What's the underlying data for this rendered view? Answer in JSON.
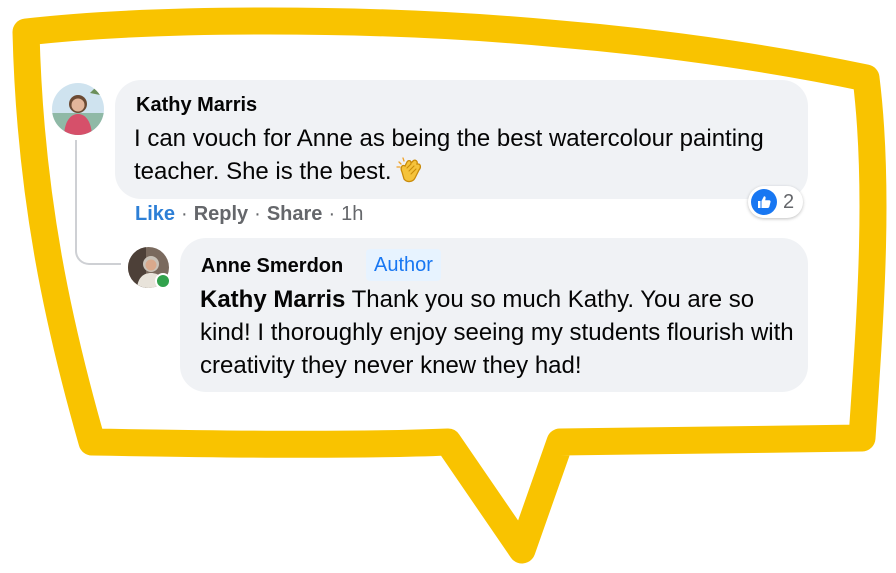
{
  "colors": {
    "frame_stroke": "#f9c300",
    "comment_bg": "#f0f2f5",
    "author_badge_bg": "#e7f3ff",
    "author_badge_text": "#1877f2",
    "like_active": "#2d7fd6",
    "meta_text": "#65676b",
    "online_status": "#31a24c"
  },
  "comment": {
    "author": "Kathy Marris",
    "avatar_icon": "profile-photo",
    "text": "I can vouch for Anne as being the best watercolour painting teacher. She is the best.",
    "emoji": "clapping-hands",
    "reactions": {
      "icon": "thumbs-up-icon",
      "count": "2"
    },
    "actions": {
      "like": "Like",
      "reply": "Reply",
      "share": "Share",
      "separator": "·",
      "time": "1h"
    }
  },
  "reply": {
    "author": "Anne Smerdon",
    "badge": "Author",
    "avatar_icon": "profile-photo",
    "online": true,
    "mention": "Kathy Marris",
    "text": "Thank you so much Kathy. You are so kind! I thoroughly enjoy seeing my students flourish with creativity they never knew they had!"
  }
}
